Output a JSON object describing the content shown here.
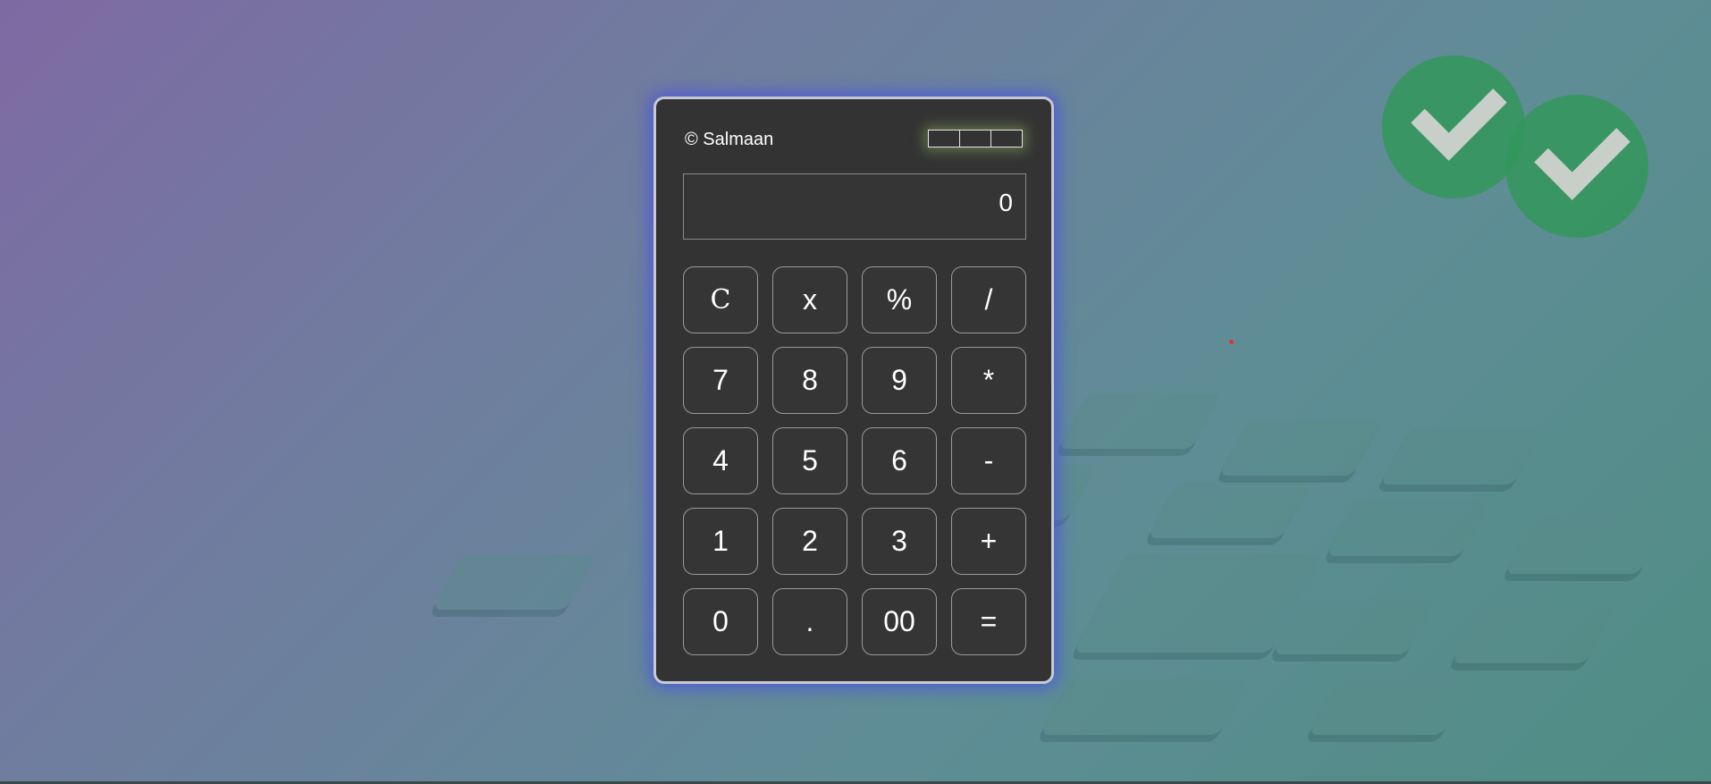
{
  "brand": "© Salmaan",
  "indicator_cells": 3,
  "display": {
    "value": "0"
  },
  "keys": [
    {
      "label": "C",
      "name": "clear-button"
    },
    {
      "label": "x",
      "name": "backspace-button"
    },
    {
      "label": "%",
      "name": "percent-button"
    },
    {
      "label": "/",
      "name": "divide-button"
    },
    {
      "label": "7",
      "name": "digit-7-button"
    },
    {
      "label": "8",
      "name": "digit-8-button"
    },
    {
      "label": "9",
      "name": "digit-9-button"
    },
    {
      "label": "*",
      "name": "multiply-button"
    },
    {
      "label": "4",
      "name": "digit-4-button"
    },
    {
      "label": "5",
      "name": "digit-5-button"
    },
    {
      "label": "6",
      "name": "digit-6-button"
    },
    {
      "label": "-",
      "name": "subtract-button"
    },
    {
      "label": "1",
      "name": "digit-1-button"
    },
    {
      "label": "2",
      "name": "digit-2-button"
    },
    {
      "label": "3",
      "name": "digit-3-button"
    },
    {
      "label": "+",
      "name": "add-button"
    },
    {
      "label": "0",
      "name": "digit-0-button"
    },
    {
      "label": ".",
      "name": "decimal-button"
    },
    {
      "label": "00",
      "name": "double-zero-button"
    },
    {
      "label": "=",
      "name": "equals-button"
    }
  ],
  "colors": {
    "panel": "#333333",
    "glow": "#4650e6",
    "text": "#ffffff"
  }
}
